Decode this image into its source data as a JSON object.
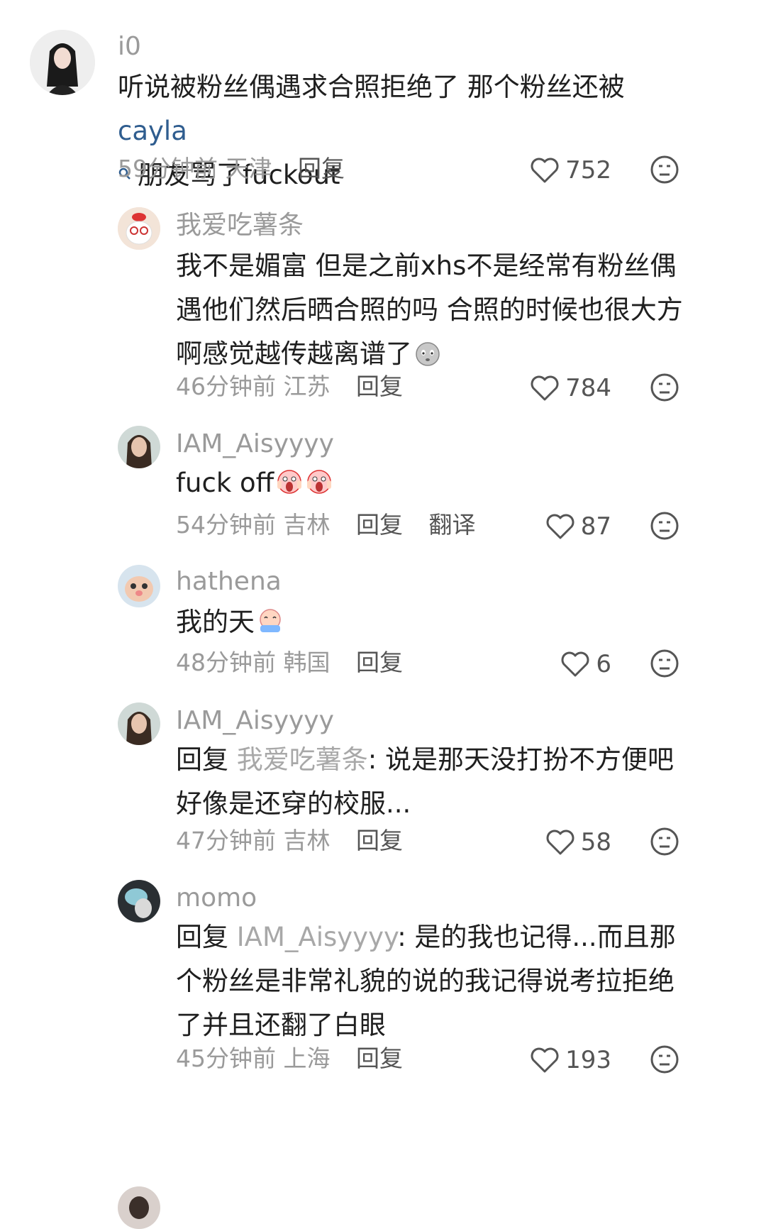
{
  "comments": [
    {
      "username": "i0",
      "text_before": "听说被粉丝偶遇求合照拒绝了 那个粉丝还被 ",
      "mention": "cayla",
      "text_after": "朋友骂了fuckout",
      "time": "59分钟前",
      "location": "天津",
      "reply": "回复",
      "likes": "752"
    },
    {
      "username": "我爱吃薯条",
      "text": "我不是媚富 但是之前xhs不是经常有粉丝偶遇他们然后晒合照的吗 合照的时候也很大方啊感觉越传越离谱了",
      "time": "46分钟前",
      "location": "江苏",
      "reply": "回复",
      "likes": "784"
    },
    {
      "username": "IAM_Aisyyyy",
      "text": "fuck off",
      "time": "54分钟前",
      "location": "吉林",
      "reply": "回复",
      "translate": "翻译",
      "likes": "87"
    },
    {
      "username": "hathena",
      "text": "我的天",
      "time": "48分钟前",
      "location": "韩国",
      "reply": "回复",
      "likes": "6"
    },
    {
      "username": "IAM_Aisyyyy",
      "reply_prefix": "回复 ",
      "reply_target": "我爱吃薯条",
      "text": ": 说是那天没打扮不方便吧好像是还穿的校服...",
      "time": "47分钟前",
      "location": "吉林",
      "reply": "回复",
      "likes": "58"
    },
    {
      "username": "momo",
      "reply_prefix": "回复 ",
      "reply_target": "IAM_Aisyyyy",
      "text": ": 是的我也记得...而且那个粉丝是非常礼貌的说的我记得说考拉拒绝了并且还翻了白眼",
      "time": "45分钟前",
      "location": "上海",
      "reply": "回复",
      "likes": "193"
    }
  ],
  "icons": {
    "like": "heart-outline-icon",
    "dislike": "meh-face-icon",
    "mention_search": "search-icon"
  },
  "colors": {
    "username": "#9a9a9a",
    "mention": "#2f5d8f",
    "meta": "#9a9a9a"
  }
}
